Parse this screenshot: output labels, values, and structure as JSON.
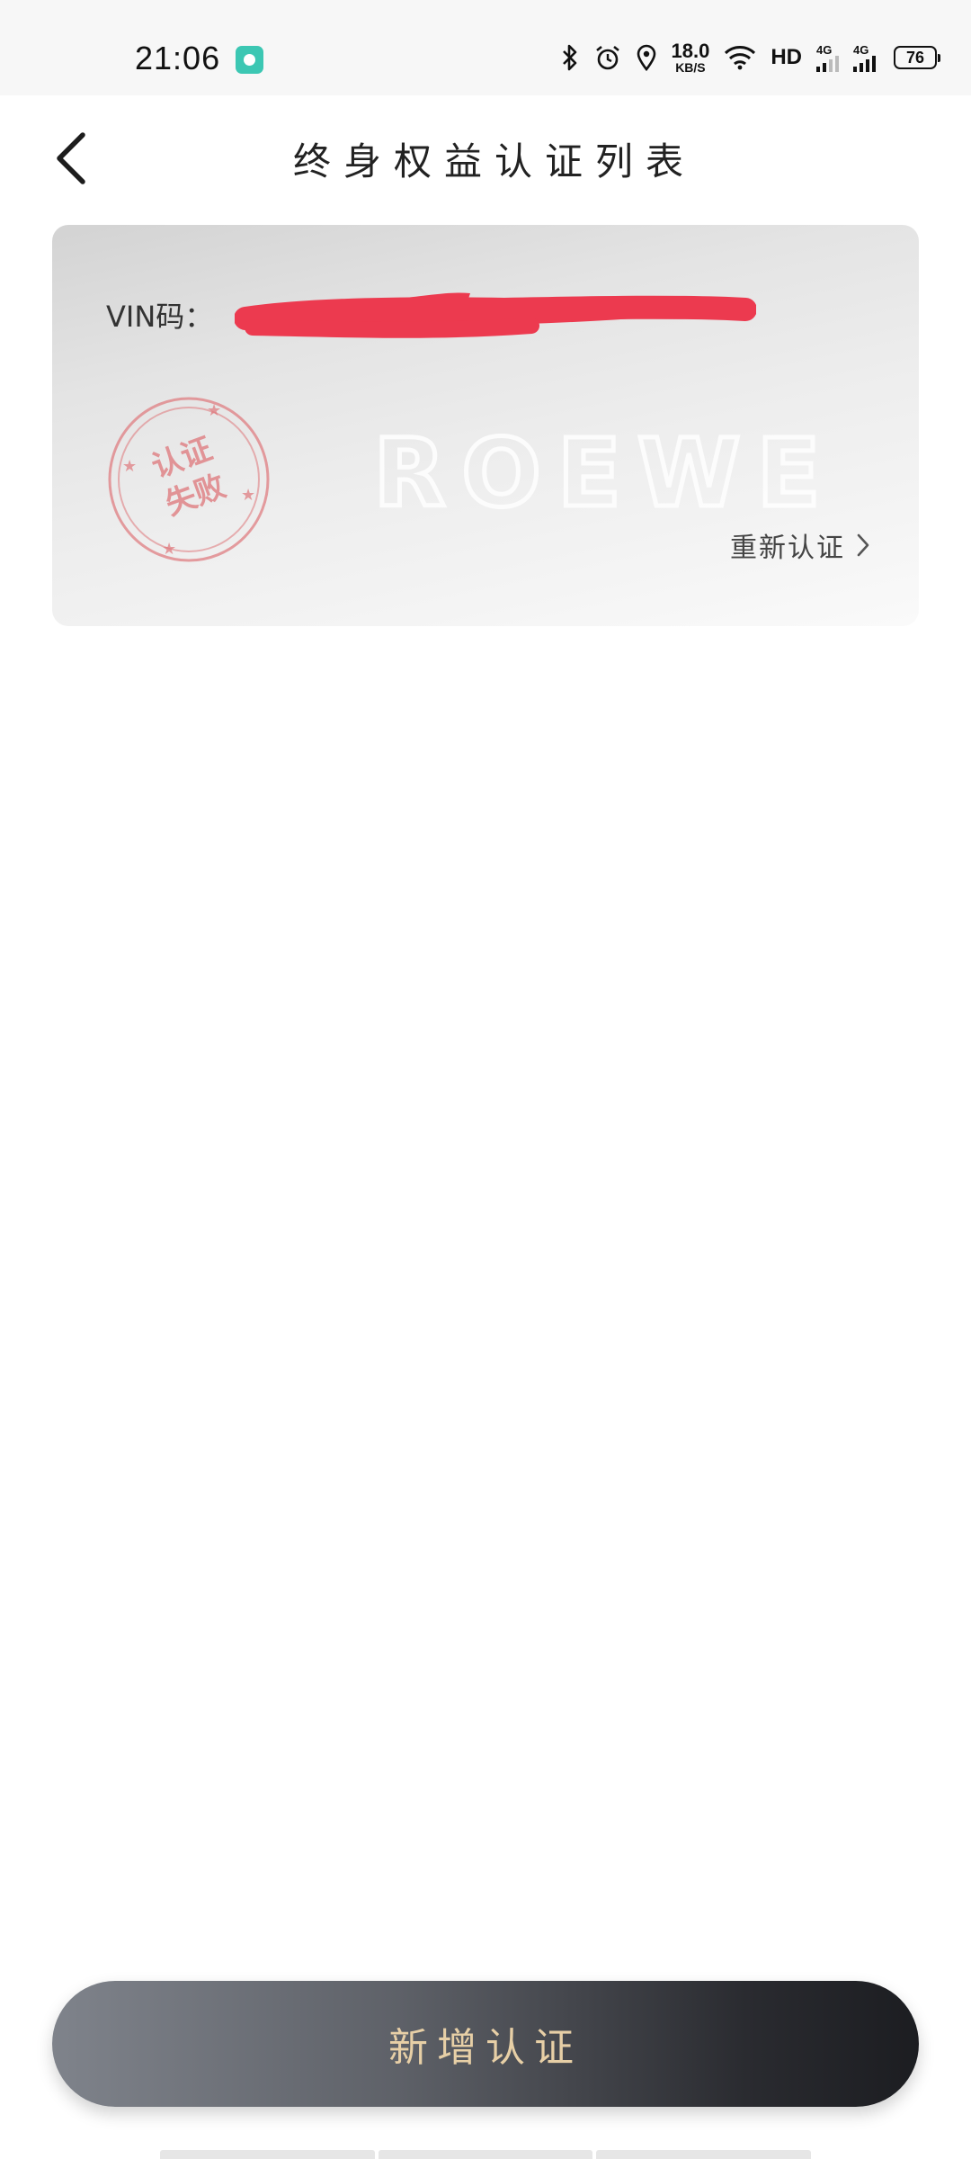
{
  "status_bar": {
    "time": "21:06",
    "speed_value": "18.0",
    "speed_unit": "KB/S",
    "hd_label": "HD",
    "net1": "4G",
    "net2": "4G",
    "battery": "76",
    "icons": [
      "app-notification-icon",
      "bluetooth-icon",
      "alarm-icon",
      "location-icon",
      "wifi-icon",
      "signal-icon",
      "battery-icon"
    ]
  },
  "header": {
    "title": "终身权益认证列表",
    "back_icon": "chevron-left-icon"
  },
  "card": {
    "vin_label": "VIN码：",
    "watermark_brand": "ROEWE",
    "stamp_line1": "认证",
    "stamp_line2": "失败",
    "action_label": "重新认证",
    "redaction_color": "#ec3a4f"
  },
  "footer": {
    "add_button_label": "新增认证"
  },
  "colors": {
    "button_text": "#e7cfa6",
    "stamp": "#de767a"
  }
}
